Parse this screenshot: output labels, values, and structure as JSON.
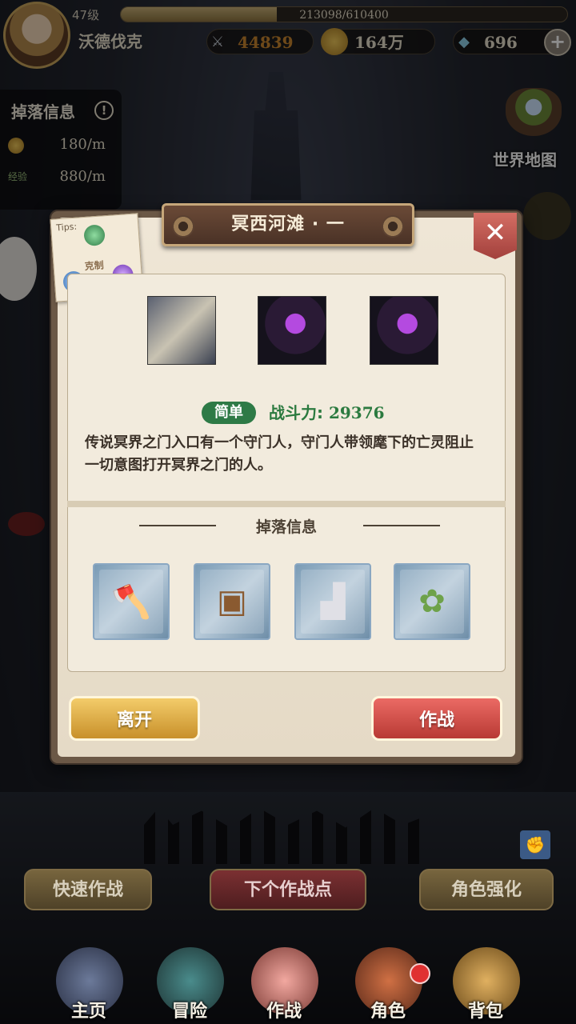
{
  "player": {
    "level": "47级",
    "name": "沃德伐克",
    "exp": {
      "current": 213098,
      "max": 610400,
      "text": "213098/610400"
    },
    "power": "44839",
    "gold": "164万",
    "gems": "696"
  },
  "drop_panel": {
    "title": "掉落信息",
    "gold_rate": "180/m",
    "exp_label": "经验",
    "exp_rate": "880/m"
  },
  "world_map": {
    "label": "世界地图"
  },
  "stage_dialog": {
    "title": "冥西河滩 · 一",
    "tips_label": "Tips:",
    "counter_label": "克制",
    "difficulty": "简单",
    "power_label": "战斗力:",
    "power_value": "29376",
    "description": "传说冥界之门入口有一个守门人，守门人带领麾下的亡灵阻止一切意图打开冥界之门的人。",
    "drop_title": "掉落信息",
    "enemies": [
      "skeleton-knight-icon",
      "hooded-wraith-icon",
      "hooded-wraith-icon"
    ],
    "drops": [
      "axe-icon",
      "armor-icon",
      "boots-icon",
      "flower-wreath-icon"
    ],
    "leave_label": "离开",
    "fight_label": "作战"
  },
  "actions": {
    "quick_battle": "快速作战",
    "next_point": "下个作战点",
    "enhance": "角色强化"
  },
  "nav": {
    "home": "主页",
    "adventure": "冒险",
    "battle": "作战",
    "character": "角色",
    "bag": "背包"
  }
}
